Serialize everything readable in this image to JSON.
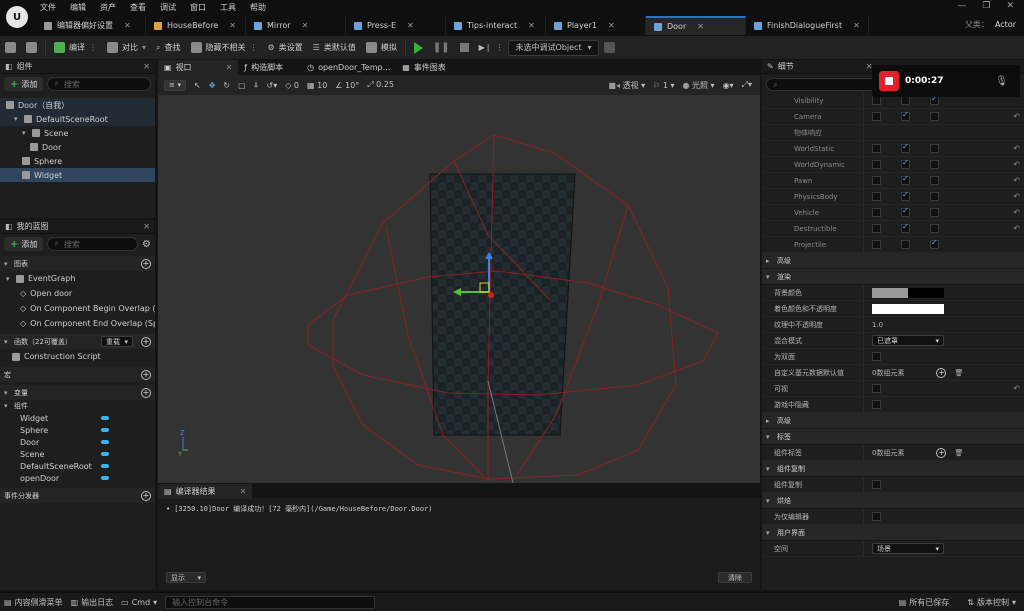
{
  "menu": [
    "文件",
    "编辑",
    "资产",
    "查看",
    "调试",
    "窗口",
    "工具",
    "帮助"
  ],
  "doc_tabs": [
    {
      "label": "编辑器偏好设置",
      "color": "#9a9a9a",
      "active": false
    },
    {
      "label": "HouseBefore",
      "color": "#e0a040",
      "active": false
    },
    {
      "label": "Mirror",
      "color": "#6aa4d6",
      "active": false
    },
    {
      "label": "Press-E",
      "color": "#6aa4d6",
      "active": false
    },
    {
      "label": "Tips-interact",
      "color": "#6aa4d6",
      "active": false
    },
    {
      "label": "Player1",
      "color": "#6aa4d6",
      "active": false
    },
    {
      "label": "Door",
      "color": "#6aa4d6",
      "active": true
    },
    {
      "label": "FinishDialogueFirst",
      "color": "#6aa4d6",
      "active": false
    }
  ],
  "parent": {
    "label": "父类：",
    "value": "Actor"
  },
  "toolbar": {
    "compile": "编译",
    "diff": "对比",
    "find": "查找",
    "hide_unrelated": "隐藏不相关",
    "class_settings": "类设置",
    "class_defaults": "类默认值",
    "simulate": "模拟",
    "debug_object": "未选中调试Object"
  },
  "components_panel": {
    "title": "组件",
    "add": "添加",
    "search_placeholder": "搜索",
    "items": [
      {
        "label": "Door（自我）",
        "indent": 0
      },
      {
        "label": "DefaultSceneRoot",
        "indent": 1
      },
      {
        "label": "Scene",
        "indent": 2
      },
      {
        "label": "Door",
        "indent": 3
      },
      {
        "label": "Sphere",
        "indent": 2
      },
      {
        "label": "Widget",
        "indent": 2
      }
    ]
  },
  "blueprint_panel": {
    "title": "我的蓝图",
    "add": "添加",
    "search_placeholder": "搜索",
    "graphs_section": "图表",
    "event_graph": "EventGraph",
    "events": [
      "Open door",
      "On Component Begin Overlap (Sph",
      "On Component End Overlap (Sphe"
    ],
    "functions_section": "函数（22可覆盖）",
    "override": "重载",
    "construction": "Construction Script",
    "macros_section": "宏",
    "variables_section": "变量",
    "components_group": "组件",
    "variables": [
      "Widget",
      "Sphere",
      "Door",
      "Scene",
      "DefaultSceneRoot",
      "openDoor"
    ],
    "dispatchers_section": "事件分发器"
  },
  "viewport": {
    "tabs": [
      "视口",
      "构造脚本",
      "openDoor_Temp...",
      "事件图表"
    ],
    "perspective": "透视",
    "lit": "光照",
    "snap_move": "10",
    "snap_rot": "10°",
    "snap_scale": "0.25",
    "zero": "0",
    "camera_speed": "1"
  },
  "compiler": {
    "title": "编译器结果",
    "log": "[3250.10]Door 编译成功！[72 毫秒内](/Game/HouseBefore/Door.Door)",
    "show": "显示",
    "clear": "清除"
  },
  "details": {
    "title": "细节",
    "rows": [
      {
        "type": "row",
        "label": "Visibility",
        "dim": true,
        "checks": [
          false,
          false,
          true
        ],
        "reset": false
      },
      {
        "type": "row",
        "label": "Camera",
        "dim": true,
        "checks": [
          false,
          true,
          false
        ],
        "reset": true
      },
      {
        "type": "row",
        "label": "物体响应",
        "dim": true,
        "checks": [],
        "reset": false
      },
      {
        "type": "row",
        "label": "WorldStatic",
        "dim": true,
        "checks": [
          false,
          true,
          false
        ],
        "reset": true
      },
      {
        "type": "row",
        "label": "WorldDynamic",
        "dim": true,
        "checks": [
          false,
          true,
          false
        ],
        "reset": true
      },
      {
        "type": "row",
        "label": "Pawn",
        "dim": true,
        "checks": [
          false,
          true,
          false
        ],
        "reset": true
      },
      {
        "type": "row",
        "label": "PhysicsBody",
        "dim": true,
        "checks": [
          false,
          true,
          false
        ],
        "reset": true
      },
      {
        "type": "row",
        "label": "Vehicle",
        "dim": true,
        "checks": [
          false,
          true,
          false
        ],
        "reset": true
      },
      {
        "type": "row",
        "label": "Destructible",
        "dim": true,
        "checks": [
          false,
          true,
          false
        ],
        "reset": true
      },
      {
        "type": "row",
        "label": "Projectile",
        "dim": true,
        "checks": [
          false,
          false,
          true
        ],
        "reset": false
      },
      {
        "type": "sect",
        "label": "高级",
        "open": false
      },
      {
        "type": "sect",
        "label": "渲染",
        "open": true
      },
      {
        "type": "swatch",
        "label": "背景颜色"
      },
      {
        "type": "white",
        "label": "着色颜色和不透明度"
      },
      {
        "type": "text",
        "label": "纹理中不透明度",
        "value": "1.0"
      },
      {
        "type": "dropdown",
        "label": "混合模式",
        "value": "已遮罩"
      },
      {
        "type": "row",
        "label": "为双面",
        "checks": [
          false
        ],
        "reset": false
      },
      {
        "type": "array",
        "label": "自定义基元数据默认值",
        "value": "0数组元素"
      },
      {
        "type": "row",
        "label": "可视",
        "checks": [
          false
        ],
        "reset": true
      },
      {
        "type": "row",
        "label": "游戏中隐藏",
        "checks": [
          false
        ],
        "reset": false
      },
      {
        "type": "sect",
        "label": "高级",
        "open": false
      },
      {
        "type": "sect",
        "label": "标签",
        "open": true
      },
      {
        "type": "array",
        "label": "组件标签",
        "value": "0数组元素"
      },
      {
        "type": "sect",
        "label": "组件复制",
        "open": true
      },
      {
        "type": "row",
        "label": "组件复制",
        "checks": [
          false
        ],
        "reset": false
      },
      {
        "type": "sect",
        "label": "烘焙",
        "open": true
      },
      {
        "type": "row",
        "label": "为仅编辑器",
        "checks": [
          false
        ],
        "reset": false
      },
      {
        "type": "sect",
        "label": "用户界面",
        "open": true
      },
      {
        "type": "dropdown",
        "label": "空间",
        "value": "场景"
      }
    ]
  },
  "recording": {
    "time": "0:00:27"
  },
  "statusbar": {
    "content_drawer": "内容侧滑菜单",
    "output_log": "输出日志",
    "cmd": "Cmd",
    "cmd_placeholder": "输入控制台命令",
    "save_all": "所有已保存",
    "source_control": "版本控制"
  }
}
